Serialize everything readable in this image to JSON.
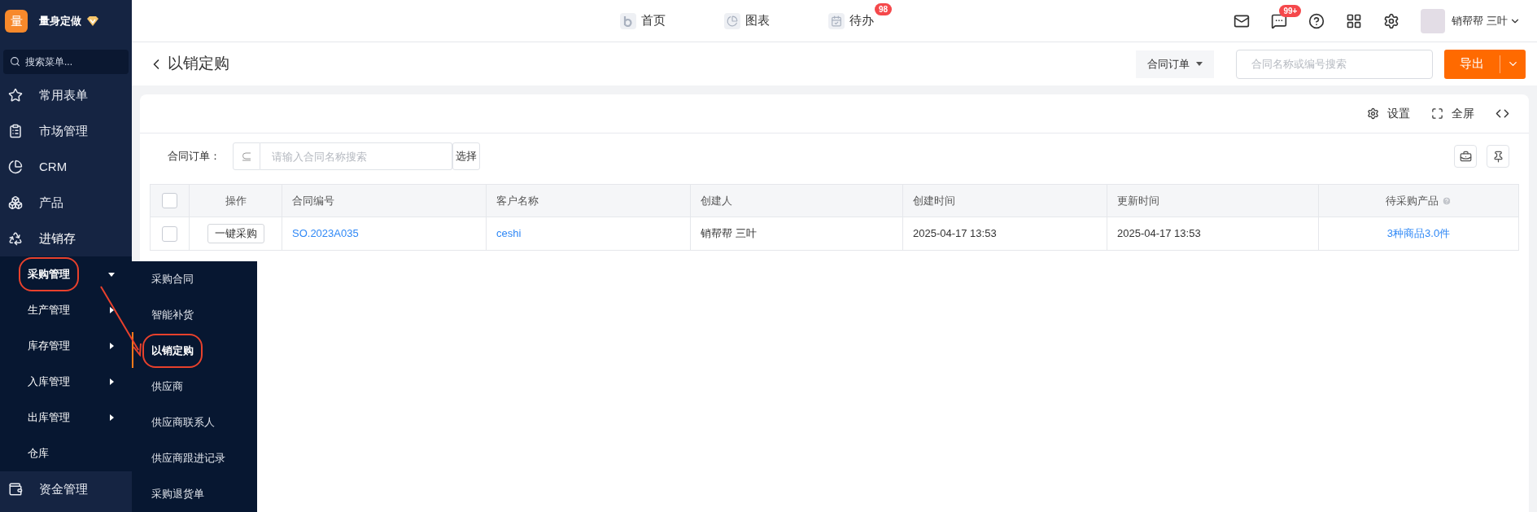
{
  "brand": {
    "logo_text": "量",
    "name": "量身定做"
  },
  "sidebar": {
    "search": {
      "placeholder": "搜索菜单..."
    },
    "items": [
      {
        "label": "常用表单",
        "expanded": false
      },
      {
        "label": "市场管理",
        "expanded": false
      },
      {
        "label": "CRM",
        "expanded": false
      },
      {
        "label": "产品",
        "expanded": false
      },
      {
        "label": "进销存",
        "expanded": true,
        "children": [
          {
            "label": "采购管理",
            "kind": "group",
            "expanded": true,
            "annotated": true
          },
          {
            "label": "生产管理",
            "kind": "group",
            "expanded": false,
            "annotated": false
          },
          {
            "label": "库存管理",
            "kind": "group",
            "expanded": false,
            "annotated": false
          },
          {
            "label": "入库管理",
            "kind": "group",
            "expanded": false,
            "annotated": false
          },
          {
            "label": "出库管理",
            "kind": "group",
            "expanded": false,
            "annotated": false
          },
          {
            "label": "仓库",
            "kind": "leaf",
            "expanded": false,
            "annotated": false
          }
        ]
      },
      {
        "label": "资金管理",
        "expanded": false
      }
    ]
  },
  "flyout": [
    {
      "label": "采购合同",
      "selected": false,
      "annotated": false
    },
    {
      "label": "智能补货",
      "selected": false,
      "annotated": false
    },
    {
      "label": "以销定购",
      "selected": true,
      "annotated": true
    },
    {
      "label": "供应商",
      "selected": false,
      "annotated": false
    },
    {
      "label": "供应商联系人",
      "selected": false,
      "annotated": false
    },
    {
      "label": "供应商跟进记录",
      "selected": false,
      "annotated": false
    },
    {
      "label": "采购退货单",
      "selected": false,
      "annotated": false
    }
  ],
  "top_nav": [
    {
      "label": "首页"
    },
    {
      "label": "图表"
    },
    {
      "label": "待办",
      "badge": "98"
    }
  ],
  "top_right": {
    "message_badge": "99+",
    "user": "销帮帮 三叶"
  },
  "page": {
    "title": "以销定购",
    "filter_dropdown": "合同订单",
    "search": {
      "placeholder": "合同名称或编号搜索"
    },
    "export": "导出"
  },
  "toolbar": [
    {
      "label": "设置"
    },
    {
      "label": "全屏"
    }
  ],
  "filter": {
    "label": "合同订单：",
    "placeholder": "请输入合同名称搜索",
    "button": "选择"
  },
  "table": {
    "select_all": {
      "checked": false
    },
    "columns": [
      {
        "label": "操作",
        "help": false
      },
      {
        "label": "合同编号",
        "help": false
      },
      {
        "label": "客户名称",
        "help": false
      },
      {
        "label": "创建人",
        "help": false
      },
      {
        "label": "创建时间",
        "help": false
      },
      {
        "label": "更新时间",
        "help": false
      },
      {
        "label": "待采购产品",
        "help": true
      }
    ],
    "rows": [
      {
        "checked": false,
        "cells": [
          {
            "kind": "button",
            "text": "一键采购"
          },
          {
            "kind": "link",
            "text": "SO.2023A035"
          },
          {
            "kind": "link",
            "text": "ceshi"
          },
          {
            "kind": "text",
            "text": "销帮帮 三叶"
          },
          {
            "kind": "text",
            "text": "2025-04-17 13:53"
          },
          {
            "kind": "text",
            "text": "2025-04-17 13:53"
          },
          {
            "kind": "link",
            "text": "3种商品3.0件"
          }
        ]
      }
    ]
  }
}
